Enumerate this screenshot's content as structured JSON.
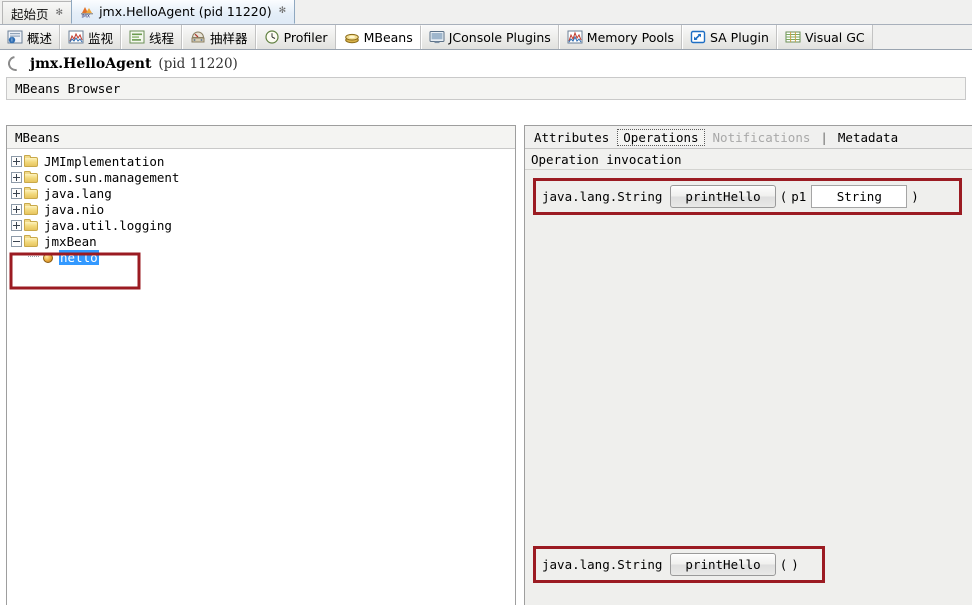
{
  "document_tabs": [
    {
      "label": "起始页",
      "icon": "none",
      "active": false,
      "close": "✻"
    },
    {
      "label": "jmx.HelloAgent  (pid 11220)",
      "icon": "jmx-icon",
      "active": true,
      "close": "✻"
    }
  ],
  "view_tabs": [
    {
      "label": "概述",
      "icon": "overview-icon",
      "active": false
    },
    {
      "label": "监视",
      "icon": "monitor-icon",
      "active": false
    },
    {
      "label": "线程",
      "icon": "threads-icon",
      "active": false
    },
    {
      "label": "抽样器",
      "icon": "sampler-icon",
      "active": false
    },
    {
      "label": "Profiler",
      "icon": "profiler-icon",
      "active": false
    },
    {
      "label": "MBeans",
      "icon": "mbeans-icon",
      "active": true
    },
    {
      "label": "JConsole Plugins",
      "icon": "jconsole-icon",
      "active": false
    },
    {
      "label": "Memory Pools",
      "icon": "memory-icon",
      "active": false
    },
    {
      "label": "SA Plugin",
      "icon": "sa-icon",
      "active": false
    },
    {
      "label": "Visual GC",
      "icon": "visualgc-icon",
      "active": false
    }
  ],
  "header": {
    "title": "jmx.HelloAgent",
    "subtitle": "(pid 11220)",
    "icon": "loading-spinner-icon"
  },
  "browser_band": {
    "label": "MBeans Browser"
  },
  "left_panel": {
    "caption": "MBeans",
    "tree": [
      {
        "label": "JMImplementation",
        "state": "collapsed",
        "icon": "folder-icon",
        "level": 0,
        "selected": false
      },
      {
        "label": "com.sun.management",
        "state": "collapsed",
        "icon": "folder-icon",
        "level": 0,
        "selected": false
      },
      {
        "label": "java.lang",
        "state": "collapsed",
        "icon": "folder-icon",
        "level": 0,
        "selected": false
      },
      {
        "label": "java.nio",
        "state": "collapsed",
        "icon": "folder-icon",
        "level": 0,
        "selected": false
      },
      {
        "label": "java.util.logging",
        "state": "collapsed",
        "icon": "folder-icon",
        "level": 0,
        "selected": false
      },
      {
        "label": "jmxBean",
        "state": "expanded",
        "icon": "folder-icon",
        "level": 0,
        "selected": false
      },
      {
        "label": "hello",
        "state": "leaf",
        "icon": "bean-icon",
        "level": 1,
        "selected": true
      }
    ]
  },
  "right_panel": {
    "tabs": [
      {
        "label": "Attributes",
        "selected": false,
        "disabled": false
      },
      {
        "label": "Operations",
        "selected": true,
        "disabled": false
      },
      {
        "label": "Notifications",
        "selected": false,
        "disabled": true
      },
      {
        "label": "Metadata",
        "selected": false,
        "disabled": false
      }
    ],
    "tab_separator": "|",
    "operation_caption": "Operation invocation",
    "operations": [
      {
        "return_type": "java.lang.String",
        "name": "printHello",
        "open_paren": "(",
        "close_paren": ")",
        "params": [
          {
            "name": "p1",
            "value": "String"
          }
        ]
      },
      {
        "return_type": "java.lang.String",
        "name": "printHello",
        "open_paren": "(",
        "close_paren": ")",
        "params": []
      }
    ]
  },
  "colors": {
    "annotation_red": "#9b1b22",
    "selection_blue": "#3399ff",
    "panel_grey": "#efefed",
    "active_tab_blue": "#dfeaf6"
  }
}
